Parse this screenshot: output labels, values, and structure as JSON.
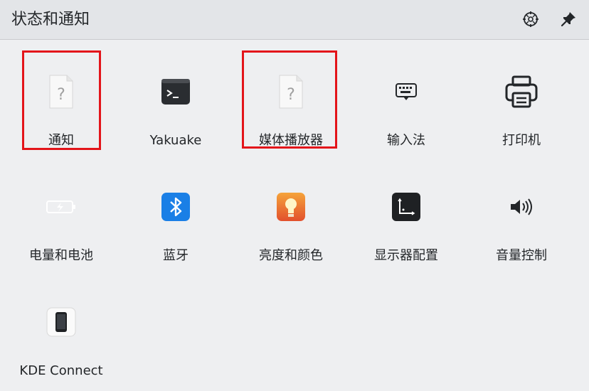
{
  "header": {
    "title": "状态和通知",
    "configure_icon": "configure-icon",
    "pin_icon": "pin-icon"
  },
  "items": [
    {
      "label": "通知",
      "icon": "unknown-file-icon"
    },
    {
      "label": "Yakuake",
      "icon": "terminal-icon"
    },
    {
      "label": "媒体播放器",
      "icon": "unknown-file-icon"
    },
    {
      "label": "输入法",
      "icon": "keyboard-icon"
    },
    {
      "label": "打印机",
      "icon": "printer-icon"
    },
    {
      "label": "电量和电池",
      "icon": "battery-icon"
    },
    {
      "label": "蓝牙",
      "icon": "bluetooth-icon"
    },
    {
      "label": "亮度和颜色",
      "icon": "lightbulb-icon"
    },
    {
      "label": "显示器配置",
      "icon": "display-config-icon"
    },
    {
      "label": "音量控制",
      "icon": "volume-icon"
    },
    {
      "label": "KDE Connect",
      "icon": "kdeconnect-phone-icon"
    }
  ],
  "highlight_color": "#e3141a"
}
